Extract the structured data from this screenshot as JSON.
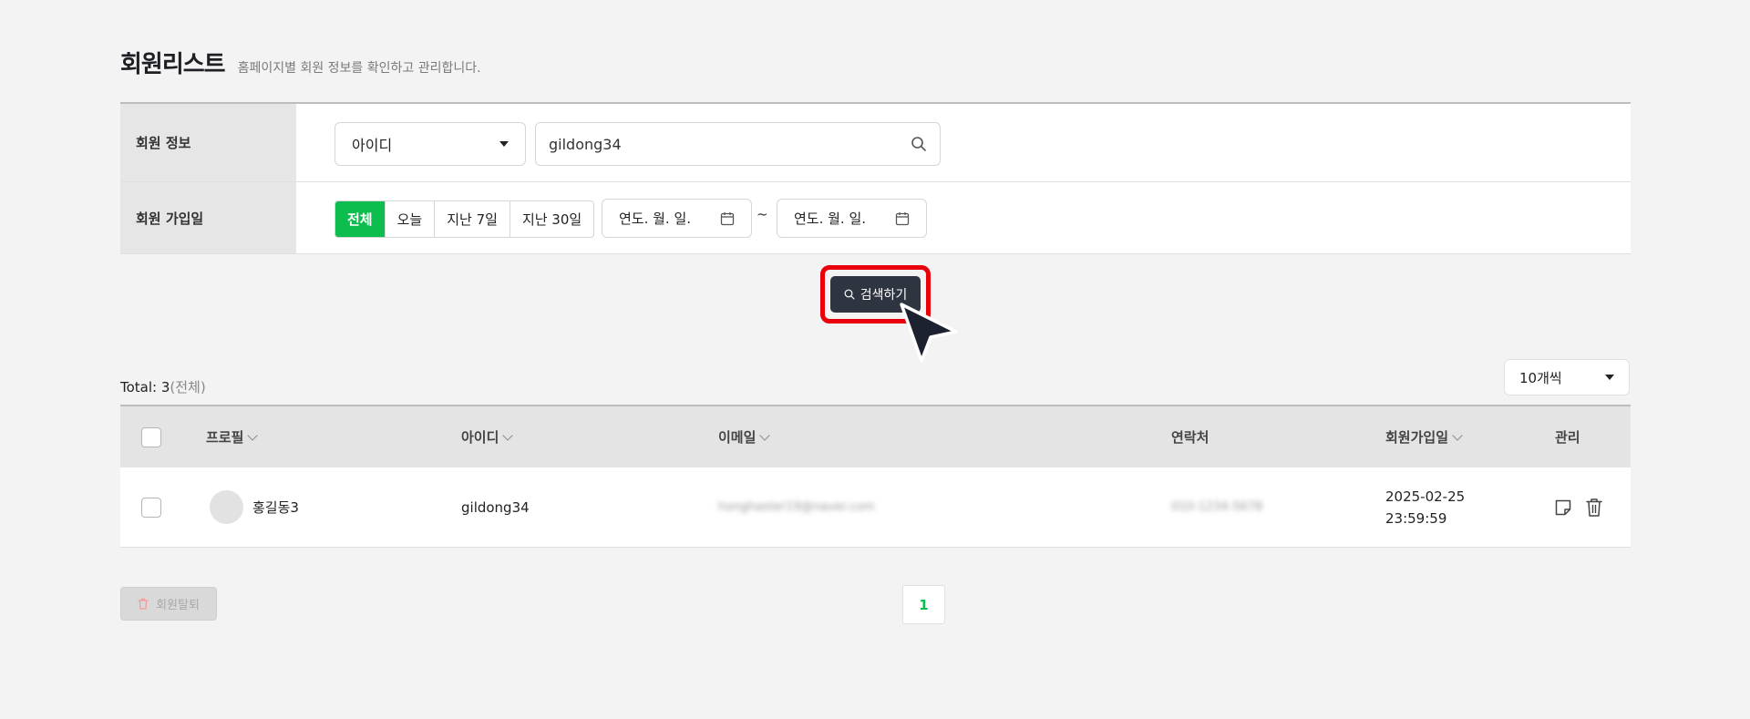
{
  "header": {
    "title": "회원리스트",
    "description": "홈페이지별 회원 정보를 확인하고 관리합니다."
  },
  "filters": {
    "member_info": {
      "label": "회원 정보",
      "field_select": "아이디",
      "search_value": "gildong34"
    },
    "join_date": {
      "label": "회원 가입일",
      "ranges": [
        "전체",
        "오늘",
        "지난 7일",
        "지난 30일"
      ],
      "active_range": "전체",
      "from_placeholder": "연도. 월. 일.",
      "separator": "~",
      "to_placeholder": "연도. 월. 일."
    },
    "search_button": "검색하기"
  },
  "list": {
    "total_label": "Total: 3",
    "total_sub": "(전체)",
    "per_page": "10개씩",
    "columns": {
      "profile": "프로필",
      "id": "아이디",
      "email": "이메일",
      "phone": "연락처",
      "joined": "회원가입일",
      "manage": "관리"
    },
    "rows": [
      {
        "name": "홍길동3",
        "id": "gildong34",
        "email": "honghaster19@naver.com",
        "phone": "010-1234-5678",
        "joined_date": "2025-02-25",
        "joined_time": "23:59:59"
      }
    ]
  },
  "footer": {
    "withdraw_button": "회원탈퇴",
    "current_page": "1"
  },
  "colors": {
    "accent_green": "#0dbd4d",
    "dark_button": "#2e3440",
    "highlight_red": "#e8000b"
  }
}
